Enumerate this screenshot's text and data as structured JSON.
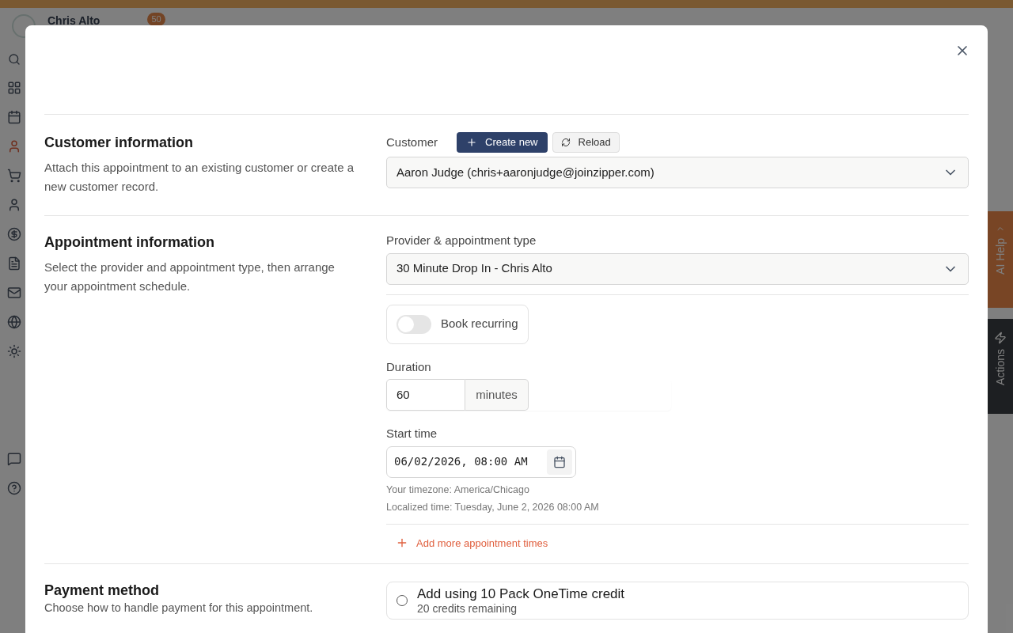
{
  "background": {
    "user_name": "Chris Alto",
    "badge": "50",
    "side_tabs": [
      {
        "label": "AI Help",
        "kind": "help"
      },
      {
        "label": "Actions",
        "kind": "actions"
      }
    ]
  },
  "customer_section": {
    "title": "Customer information",
    "description": "Attach this appointment to an existing customer or create a new customer record.",
    "field_label": "Customer",
    "create_button": "Create new",
    "reload_button": "Reload",
    "value": "Aaron Judge (chris+aaronjudge@joinzipper.com)"
  },
  "appointment_section": {
    "title": "Appointment information",
    "description": "Select the provider and appointment type, then arrange your appointment schedule.",
    "provider_label": "Provider & appointment type",
    "provider_value": "30 Minute Drop In - Chris Alto",
    "recurring": {
      "label": "Book recurring",
      "on": false
    },
    "duration_label": "Duration",
    "duration_value": "60",
    "duration_unit": "minutes",
    "start_label": "Start time",
    "start_value": "06/02/2026, 08:00 AM",
    "timezone": "Your timezone: America/Chicago",
    "localized": "Localized time: Tuesday, June 2, 2026 08:00 AM",
    "add_more": "Add more appointment times"
  },
  "payment_section": {
    "title": "Payment method",
    "description": "Choose how to handle payment for this appointment.",
    "options": [
      {
        "title": "Add using 10 Pack OneTime credit",
        "subtitle": "20 credits remaining",
        "selected": false
      }
    ]
  }
}
